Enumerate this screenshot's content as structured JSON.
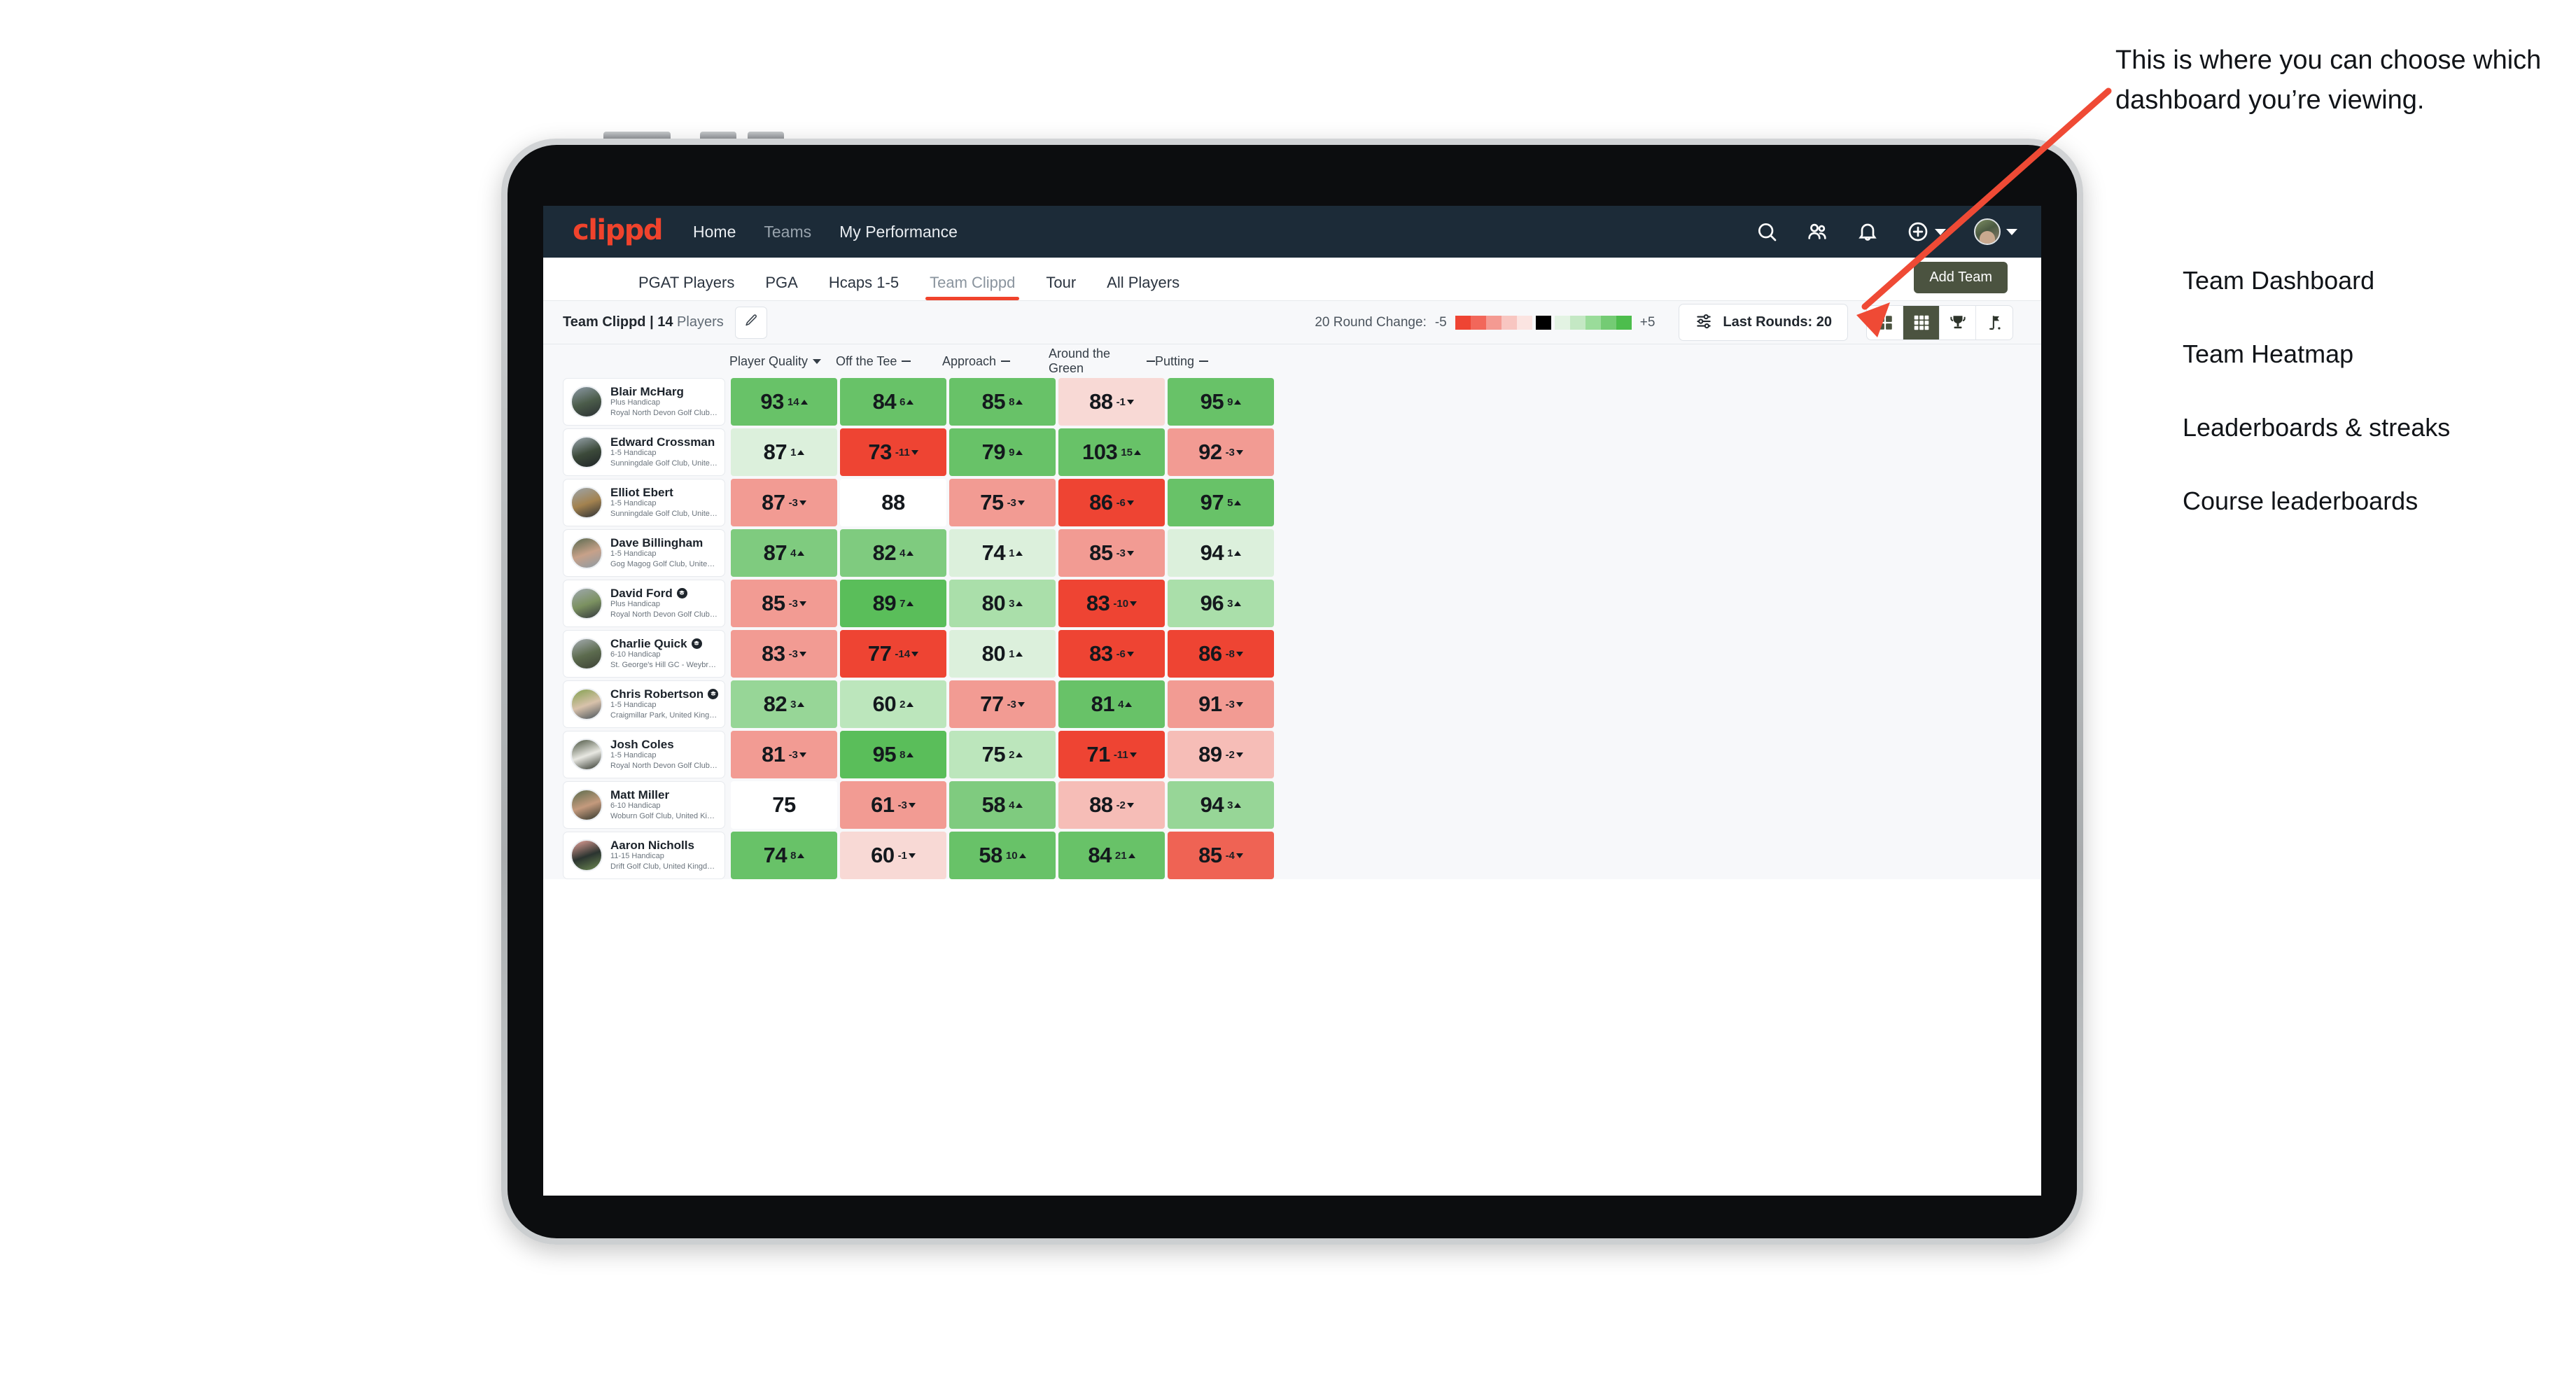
{
  "topnav": {
    "logo": "clippd",
    "links": [
      {
        "label": "Home",
        "active": true
      },
      {
        "label": "Teams",
        "active": false
      },
      {
        "label": "My Performance",
        "active": true
      }
    ],
    "icons": [
      "search-icon",
      "people-icon",
      "bell-icon",
      "plus-circle-icon",
      "avatar"
    ],
    "brand_color": "#f0432c",
    "bar_color": "#1c2b38"
  },
  "subnav": {
    "tabs": [
      {
        "label": "PGAT Players",
        "active": false
      },
      {
        "label": "PGA",
        "active": false
      },
      {
        "label": "Hcaps 1-5",
        "active": false
      },
      {
        "label": "Team Clippd",
        "active": true
      },
      {
        "label": "Tour",
        "active": false
      },
      {
        "label": "All Players",
        "active": false
      }
    ],
    "add_team_label": "Add Team",
    "active_indicator_color": "#f0432c"
  },
  "toolbar": {
    "team_name": "Team Clippd",
    "separator": "|",
    "player_count": "14",
    "players_word": "Players",
    "edit_icon": "pencil-icon",
    "legend_label": "20 Round Change:",
    "legend_min": "-5",
    "legend_max": "+5",
    "rounds_label": "Last Rounds: 20",
    "rounds_icon": "sliders-icon",
    "views": [
      {
        "name": "dashboard-grid-icon",
        "active": false
      },
      {
        "name": "heatmap-grid-icon",
        "active": true
      },
      {
        "name": "trophy-icon",
        "active": false
      },
      {
        "name": "flag-icon",
        "active": false
      }
    ]
  },
  "table": {
    "columns": [
      {
        "label": "Player Quality",
        "marker": "caret"
      },
      {
        "label": "Off the Tee",
        "marker": "dash"
      },
      {
        "label": "Approach",
        "marker": "dash"
      },
      {
        "label": "Around the Green",
        "marker": "dash"
      },
      {
        "label": "Putting",
        "marker": "dash"
      }
    ],
    "rows": [
      {
        "name": "Blair McHarg",
        "badge": false,
        "handicap": "Plus Handicap",
        "club": "Royal North Devon Golf Club, United Kingdom",
        "avatar_colors": [
          "#8d9aa6",
          "#4b5c4a",
          "#2a2f33"
        ],
        "cells": [
          {
            "value": "93",
            "delta": "14",
            "dir": "up",
            "bg": "#68c268"
          },
          {
            "value": "84",
            "delta": "6",
            "dir": "up",
            "bg": "#68c268"
          },
          {
            "value": "85",
            "delta": "8",
            "dir": "up",
            "bg": "#68c268"
          },
          {
            "value": "88",
            "delta": "-1",
            "dir": "down",
            "bg": "#f8d9d5"
          },
          {
            "value": "95",
            "delta": "9",
            "dir": "up",
            "bg": "#68c268"
          }
        ]
      },
      {
        "name": "Edward Crossman",
        "badge": false,
        "handicap": "1-5 Handicap",
        "club": "Sunningdale Golf Club, United Kingdom",
        "avatar_colors": [
          "#9aa6ae",
          "#3c4a3a",
          "#1f2428"
        ],
        "cells": [
          {
            "value": "87",
            "delta": "1",
            "dir": "up",
            "bg": "#dcf0dc"
          },
          {
            "value": "73",
            "delta": "-11",
            "dir": "down",
            "bg": "#ee4433"
          },
          {
            "value": "79",
            "delta": "9",
            "dir": "up",
            "bg": "#68c268"
          },
          {
            "value": "103",
            "delta": "15",
            "dir": "up",
            "bg": "#68c268"
          },
          {
            "value": "92",
            "delta": "-3",
            "dir": "down",
            "bg": "#f29b93"
          }
        ]
      },
      {
        "name": "Elliot Ebert",
        "badge": false,
        "handicap": "1-5 Handicap",
        "club": "Sunningdale Golf Club, United Kingdom",
        "avatar_colors": [
          "#9ca5ab",
          "#a3824f",
          "#2c3136"
        ],
        "cells": [
          {
            "value": "87",
            "delta": "-3",
            "dir": "down",
            "bg": "#f29b93"
          },
          {
            "value": "88",
            "delta": "",
            "dir": "none",
            "bg": "#ffffff"
          },
          {
            "value": "75",
            "delta": "-3",
            "dir": "down",
            "bg": "#f29b93"
          },
          {
            "value": "86",
            "delta": "-6",
            "dir": "down",
            "bg": "#ee4433"
          },
          {
            "value": "97",
            "delta": "5",
            "dir": "up",
            "bg": "#68c268"
          }
        ]
      },
      {
        "name": "Dave Billingham",
        "badge": false,
        "handicap": "1-5 Handicap",
        "club": "Gog Magog Golf Club, United Kingdom",
        "avatar_colors": [
          "#59694f",
          "#c7a189",
          "#8c9aa3"
        ],
        "cells": [
          {
            "value": "87",
            "delta": "4",
            "dir": "up",
            "bg": "#7fcb7f"
          },
          {
            "value": "82",
            "delta": "4",
            "dir": "up",
            "bg": "#7fcb7f"
          },
          {
            "value": "74",
            "delta": "1",
            "dir": "up",
            "bg": "#dcf0dc"
          },
          {
            "value": "85",
            "delta": "-3",
            "dir": "down",
            "bg": "#f29b93"
          },
          {
            "value": "94",
            "delta": "1",
            "dir": "up",
            "bg": "#dcf0dc"
          }
        ]
      },
      {
        "name": "David Ford",
        "badge": true,
        "handicap": "Plus Handicap",
        "club": "Royal North Devon Golf Club, United Kingdom",
        "avatar_colors": [
          "#9fa8af",
          "#7b9160",
          "#33383d"
        ],
        "cells": [
          {
            "value": "85",
            "delta": "-3",
            "dir": "down",
            "bg": "#f29b93"
          },
          {
            "value": "89",
            "delta": "7",
            "dir": "up",
            "bg": "#5abe5a"
          },
          {
            "value": "80",
            "delta": "3",
            "dir": "up",
            "bg": "#aadfaa"
          },
          {
            "value": "83",
            "delta": "-10",
            "dir": "down",
            "bg": "#ee4433"
          },
          {
            "value": "96",
            "delta": "3",
            "dir": "up",
            "bg": "#aadfaa"
          }
        ]
      },
      {
        "name": "Charlie Quick",
        "badge": true,
        "handicap": "6-10 Handicap",
        "club": "St. George's Hill GC - Weybridge - Surrey, Uni...",
        "avatar_colors": [
          "#a6adb2",
          "#5c6b4e",
          "#3c4136"
        ],
        "cells": [
          {
            "value": "83",
            "delta": "-3",
            "dir": "down",
            "bg": "#f29b93"
          },
          {
            "value": "77",
            "delta": "-14",
            "dir": "down",
            "bg": "#ee4433"
          },
          {
            "value": "80",
            "delta": "1",
            "dir": "up",
            "bg": "#dcf0dc"
          },
          {
            "value": "83",
            "delta": "-6",
            "dir": "down",
            "bg": "#ee4433"
          },
          {
            "value": "86",
            "delta": "-8",
            "dir": "down",
            "bg": "#ee4433"
          }
        ]
      },
      {
        "name": "Chris Robertson",
        "badge": true,
        "handicap": "1-5 Handicap",
        "club": "Craigmillar Park, United Kingdom",
        "avatar_colors": [
          "#83a04f",
          "#d8c2ab",
          "#46515a"
        ],
        "cells": [
          {
            "value": "82",
            "delta": "3",
            "dir": "up",
            "bg": "#97d697"
          },
          {
            "value": "60",
            "delta": "2",
            "dir": "up",
            "bg": "#bce6bc"
          },
          {
            "value": "77",
            "delta": "-3",
            "dir": "down",
            "bg": "#f29b93"
          },
          {
            "value": "81",
            "delta": "4",
            "dir": "up",
            "bg": "#68c268"
          },
          {
            "value": "91",
            "delta": "-3",
            "dir": "down",
            "bg": "#f29b93"
          }
        ]
      },
      {
        "name": "Josh Coles",
        "badge": false,
        "handicap": "1-5 Handicap",
        "club": "Royal North Devon Golf Club, United Kingdom",
        "avatar_colors": [
          "#4a5340",
          "#e8e8e2",
          "#2e332a"
        ],
        "cells": [
          {
            "value": "81",
            "delta": "-3",
            "dir": "down",
            "bg": "#f29b93"
          },
          {
            "value": "95",
            "delta": "8",
            "dir": "up",
            "bg": "#5abe5a"
          },
          {
            "value": "75",
            "delta": "2",
            "dir": "up",
            "bg": "#bce6bc"
          },
          {
            "value": "71",
            "delta": "-11",
            "dir": "down",
            "bg": "#ee4433"
          },
          {
            "value": "89",
            "delta": "-2",
            "dir": "down",
            "bg": "#f6bdb7"
          }
        ]
      },
      {
        "name": "Matt Miller",
        "badge": false,
        "handicap": "6-10 Handicap",
        "club": "Woburn Golf Club, United Kingdom",
        "avatar_colors": [
          "#5b6b4c",
          "#c49a7d",
          "#30362c"
        ],
        "cells": [
          {
            "value": "75",
            "delta": "",
            "dir": "none",
            "bg": "#ffffff"
          },
          {
            "value": "61",
            "delta": "-3",
            "dir": "down",
            "bg": "#f29b93"
          },
          {
            "value": "58",
            "delta": "4",
            "dir": "up",
            "bg": "#7fcb7f"
          },
          {
            "value": "88",
            "delta": "-2",
            "dir": "down",
            "bg": "#f6bdb7"
          },
          {
            "value": "94",
            "delta": "3",
            "dir": "up",
            "bg": "#97d697"
          }
        ]
      },
      {
        "name": "Aaron Nicholls",
        "badge": false,
        "handicap": "11-15 Handicap",
        "club": "Drift Golf Club, United Kingdom",
        "avatar_colors": [
          "#e8a39a",
          "#2b3430",
          "#6d8a52"
        ],
        "cells": [
          {
            "value": "74",
            "delta": "8",
            "dir": "up",
            "bg": "#68c268"
          },
          {
            "value": "60",
            "delta": "-1",
            "dir": "down",
            "bg": "#f8d9d5"
          },
          {
            "value": "58",
            "delta": "10",
            "dir": "up",
            "bg": "#68c268"
          },
          {
            "value": "84",
            "delta": "21",
            "dir": "up",
            "bg": "#68c268"
          },
          {
            "value": "85",
            "delta": "-4",
            "dir": "down",
            "bg": "#ef6354"
          }
        ]
      }
    ]
  },
  "annotation": {
    "paragraph": "This is where you can choose which dashboard you’re viewing.",
    "items": [
      "Team Dashboard",
      "Team Heatmap",
      "Leaderboards & streaks",
      "Course leaderboards"
    ],
    "arrow_color": "#ef4a35"
  }
}
